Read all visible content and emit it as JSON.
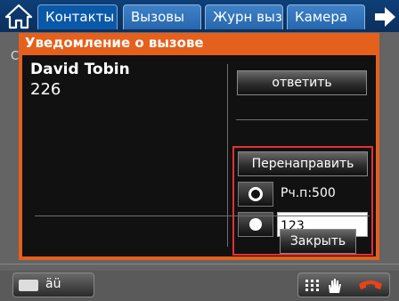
{
  "tabs": [
    {
      "label": "Контакты",
      "active": true
    },
    {
      "label": "Вызовы",
      "active": false
    },
    {
      "label": "Журн выз",
      "active": false
    },
    {
      "label": "Камера",
      "active": false
    }
  ],
  "icons": {
    "home": "home-icon",
    "next": "arrow-right-icon",
    "keyboard": "keyboard-icon",
    "dialpad": "dialpad-icon",
    "hand": "hand-icon",
    "hangup": "hangup-icon"
  },
  "background": {
    "letter": "С"
  },
  "dialog": {
    "title": "Уведомление о вызове",
    "caller_name": "David Tobin",
    "caller_number": "226",
    "answer_label": "ответить",
    "redirect_label": "Перенаправить",
    "option1_label": "Рч.п:500",
    "option2_value": "123",
    "close_label": "Закрыть"
  },
  "bottom": {
    "keyboard_label": "äü"
  },
  "colors": {
    "accent": "#e4601c",
    "highlight": "#e23232",
    "tab_active": "#0a58a8",
    "tab_inactive": "#3076c0"
  }
}
